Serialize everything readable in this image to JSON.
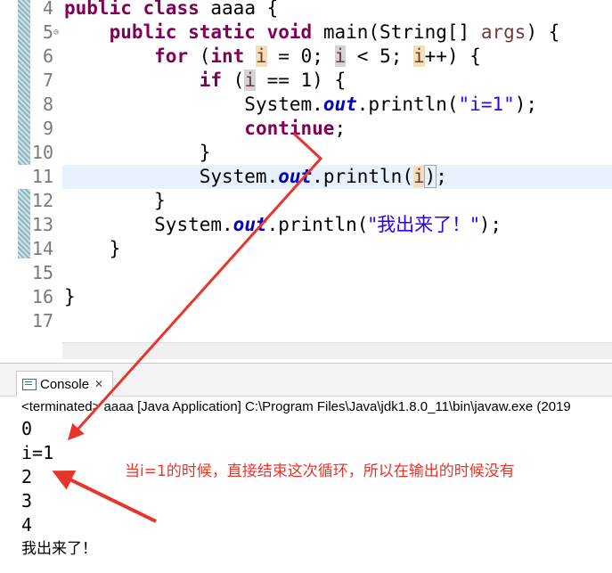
{
  "editor": {
    "lines": [
      {
        "no": "4"
      },
      {
        "no": "5"
      },
      {
        "no": "6"
      },
      {
        "no": "7"
      },
      {
        "no": "8"
      },
      {
        "no": "9"
      },
      {
        "no": "10"
      },
      {
        "no": "11"
      },
      {
        "no": "12"
      },
      {
        "no": "13"
      },
      {
        "no": "14"
      },
      {
        "no": "15"
      },
      {
        "no": "16"
      },
      {
        "no": "17"
      }
    ],
    "tokens": {
      "public": "public",
      "class": "class",
      "class_name": "aaaa {",
      "static": "static",
      "void": "void",
      "main_sig_a": "main(String[] ",
      "args": "args",
      "main_sig_b": ") {",
      "for": "for",
      "int": "int",
      "var_i": "i",
      "for_init": " = 0; ",
      "for_cond": " < 5; ",
      "for_incr": "++) {",
      "if": "if",
      "if_cond": " == 1) {",
      "system": "System.",
      "out": "out",
      "println_open": ".println(",
      "str_i1": "\"i=1\"",
      "close_stmt": ");",
      "continue": "continue",
      "semicolon": ";",
      "brace_close": "}",
      "paren_open": "(",
      "paren_close": ")",
      "str_done": "\"我出来了！\""
    }
  },
  "console": {
    "tab_label": "Console",
    "status": "<terminated> aaaa [Java Application] C:\\Program Files\\Java\\jdk1.8.0_11\\bin\\javaw.exe (2019",
    "output": [
      "0",
      "i=1",
      "2",
      "3",
      "4",
      "我出来了！"
    ]
  },
  "annotation": {
    "text": "当i=1的时候，直接结束这次循环，所以在输出的时候没有",
    "color": "#e8352c"
  },
  "colors": {
    "keyword": "#7f0055",
    "string": "#2a00ff",
    "static_field": "#0000c0",
    "current_line": "#e8f2fe"
  }
}
